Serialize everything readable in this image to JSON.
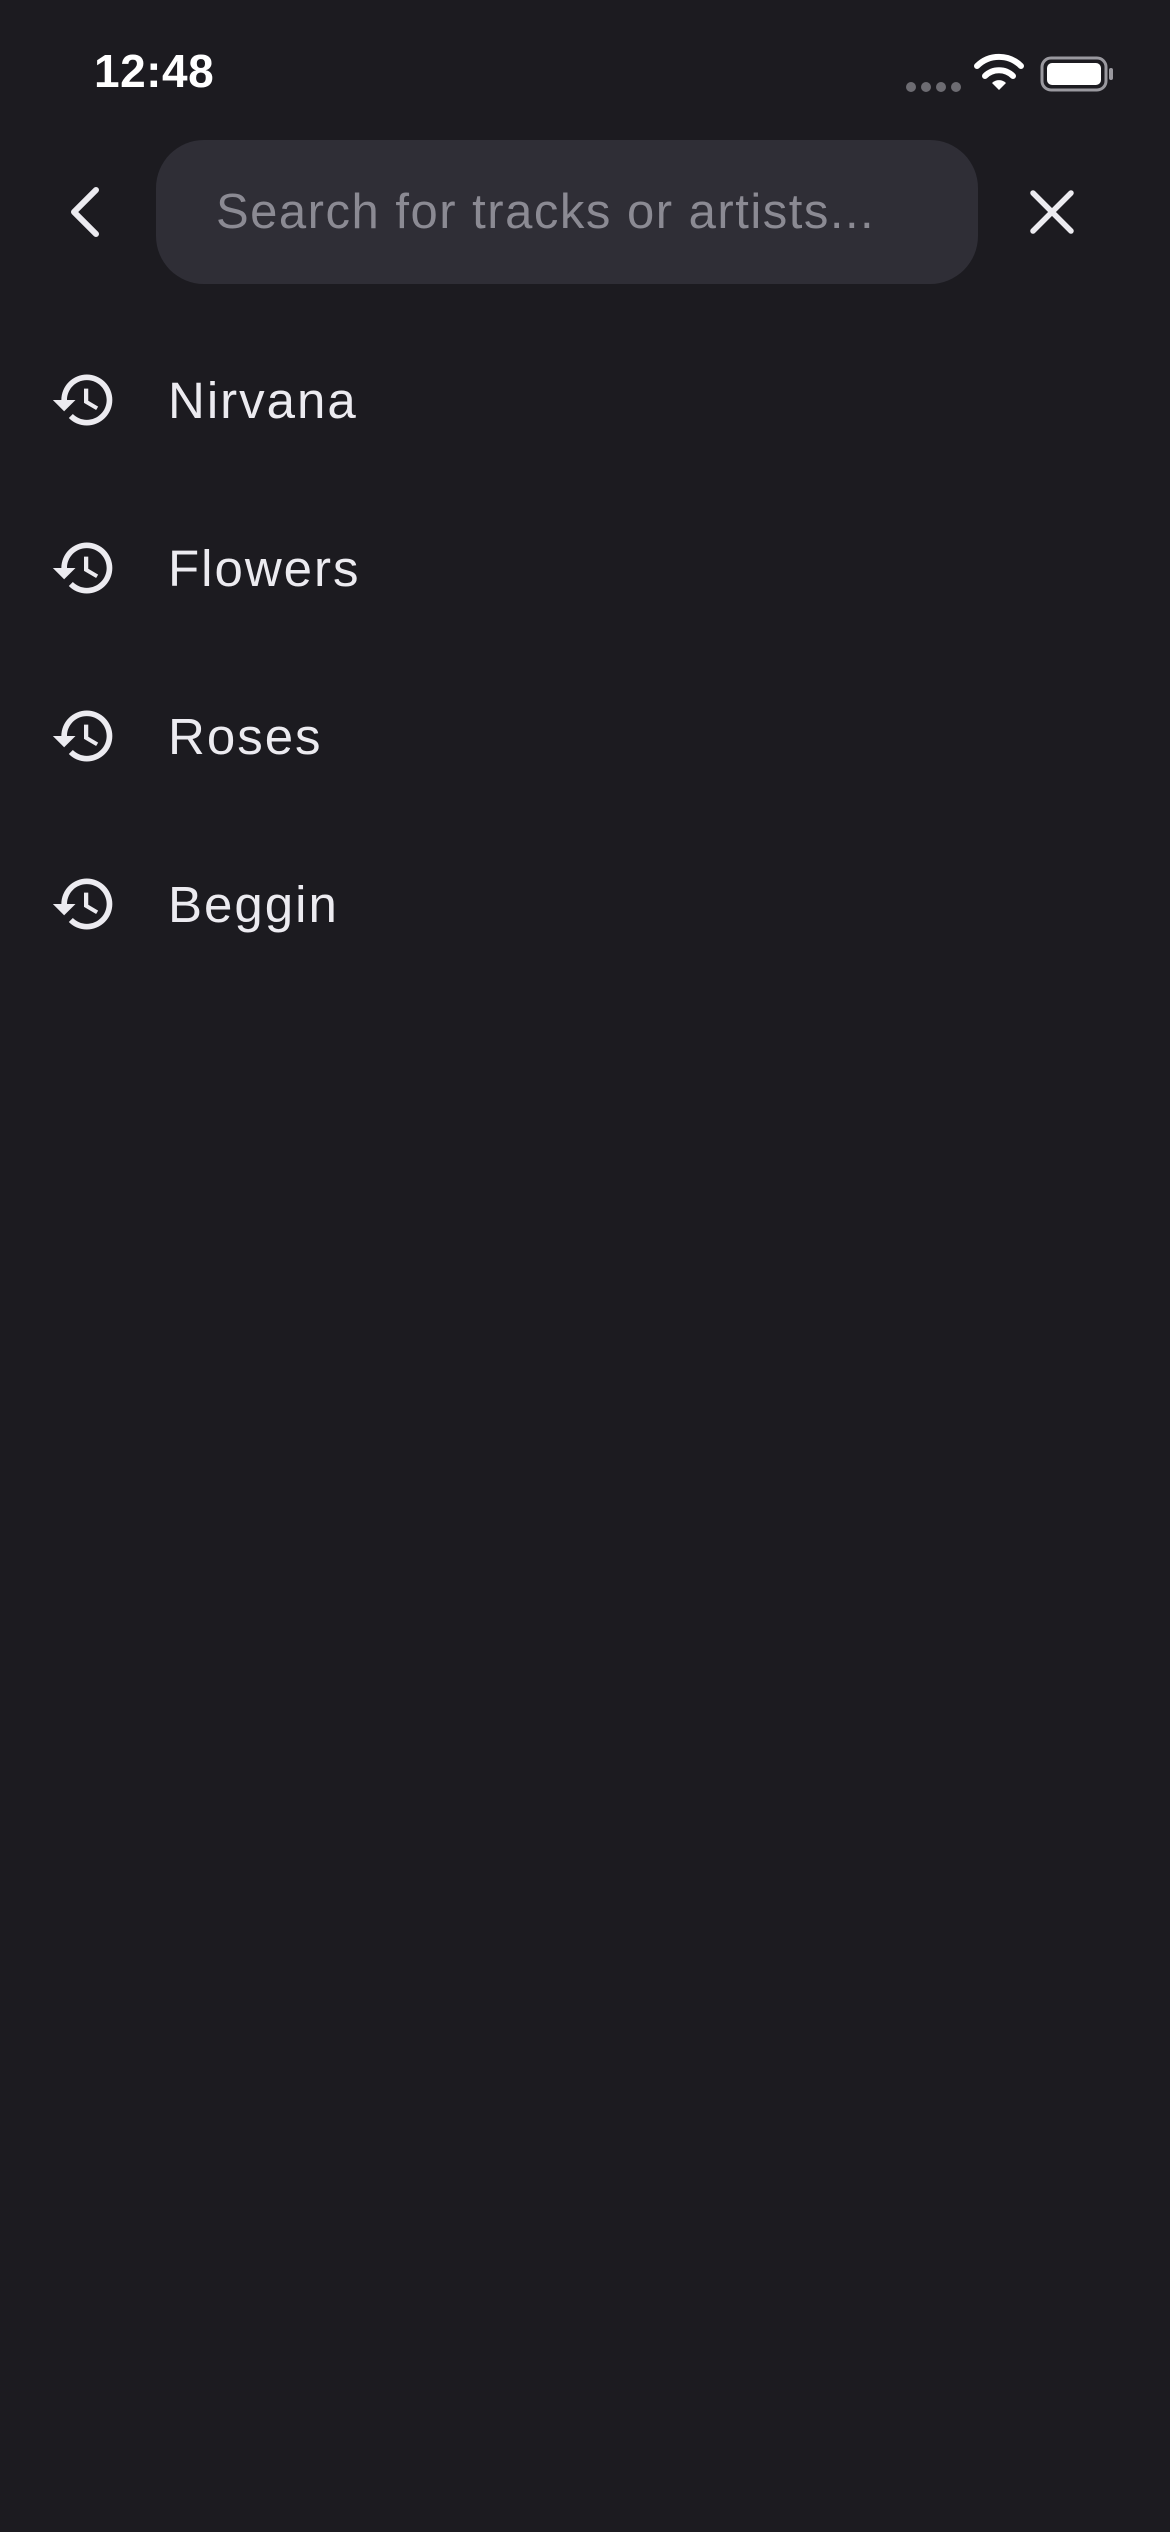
{
  "status_bar": {
    "time": "12:48",
    "signal_icon": "cellular-signal-dots-icon",
    "wifi_icon": "wifi-icon",
    "battery_icon": "battery-full-icon"
  },
  "header": {
    "back_icon": "chevron-left-icon",
    "clear_icon": "close-icon"
  },
  "search": {
    "value": "",
    "placeholder": "Search for tracks or artists..."
  },
  "history": {
    "icon": "history-icon",
    "items": [
      {
        "label": "Nirvana"
      },
      {
        "label": "Flowers"
      },
      {
        "label": "Roses"
      },
      {
        "label": "Beggin"
      }
    ]
  },
  "colors": {
    "background": "#1c1b20",
    "search_background": "#2f2e36",
    "text": "#ecebf0",
    "placeholder": "#8b8a93"
  }
}
